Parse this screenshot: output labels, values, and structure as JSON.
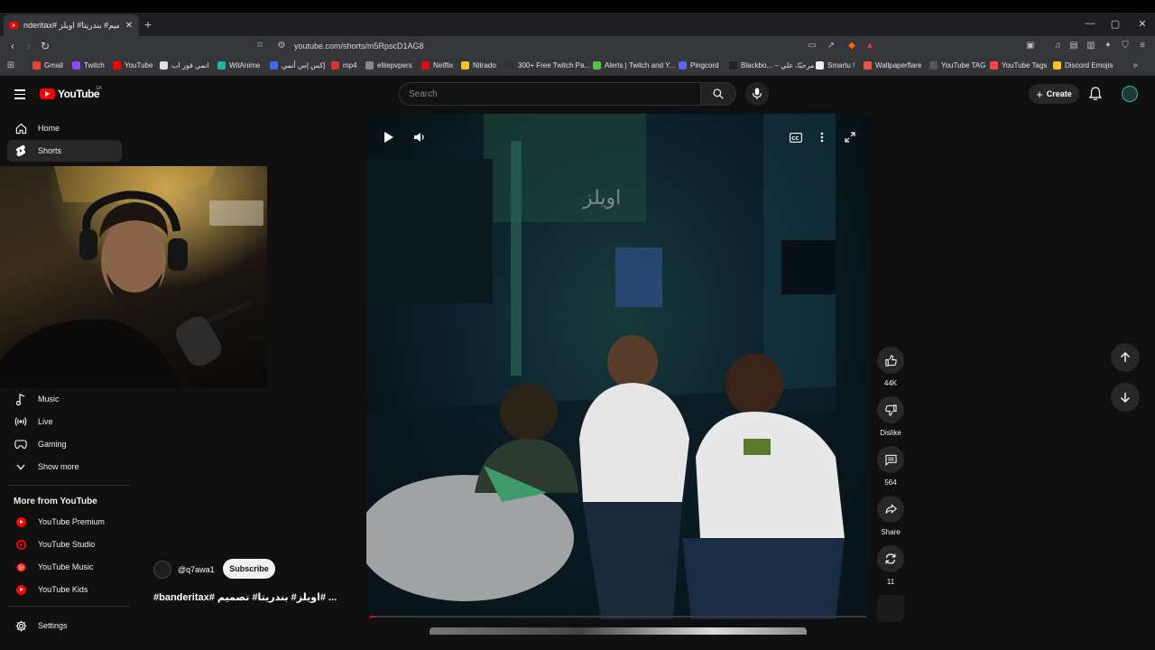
{
  "browser": {
    "tab_title": "nderitax# تصميم# بندريتا# اويلز#",
    "url": "youtube.com/shorts/m5RpscD1AG8",
    "bookmarks": [
      {
        "label": "Gmail",
        "color": "#ea4335"
      },
      {
        "label": "Twitch",
        "color": "#9146ff"
      },
      {
        "label": "YouTube",
        "color": "#ff0000"
      },
      {
        "label": "انمي فور اب",
        "color": "#e0e0e0"
      },
      {
        "label": "WitAnime",
        "color": "#1fb5a5"
      },
      {
        "label": "إكس إس أنمي",
        "color": "#3a6ee8"
      },
      {
        "label": "mp4",
        "color": "#d33"
      },
      {
        "label": "elitepvpers",
        "color": "#888"
      },
      {
        "label": "Netflix",
        "color": "#e50914"
      },
      {
        "label": "Nitrado",
        "color": "#f5c518"
      },
      {
        "label": "300+ Free Twitch Pa...",
        "color": "#333"
      },
      {
        "label": "Alerts | Twitch and Y...",
        "color": "#53c24b"
      },
      {
        "label": "Pingcord",
        "color": "#5865f2"
      },
      {
        "label": "Blackbo... – مرحبًا، علي",
        "color": "#222"
      },
      {
        "label": "Smartu !",
        "color": "#eee"
      },
      {
        "label": "Wallpaperflare",
        "color": "#e54"
      },
      {
        "label": "YouTube TAG",
        "color": "#555"
      },
      {
        "label": "YouTube Tags",
        "color": "#f44"
      },
      {
        "label": "Discord Emojis",
        "color": "#f5c518"
      }
    ]
  },
  "header": {
    "logo_text": "YouTube",
    "country_code": "SA",
    "search_placeholder": "Search",
    "create_label": "Create"
  },
  "sidebar": {
    "top_items": [
      {
        "label": "Home",
        "icon": "home-icon"
      },
      {
        "label": "Shorts",
        "icon": "shorts-icon"
      }
    ],
    "explore_items": [
      {
        "label": "Music",
        "icon": "music-icon"
      },
      {
        "label": "Live",
        "icon": "live-icon"
      },
      {
        "label": "Gaming",
        "icon": "gaming-icon"
      },
      {
        "label": "Show more",
        "icon": "chevron-down-icon"
      }
    ],
    "more_heading": "More from YouTube",
    "more_items": [
      {
        "label": "YouTube Premium"
      },
      {
        "label": "YouTube Studio"
      },
      {
        "label": "YouTube Music"
      },
      {
        "label": "YouTube Kids"
      }
    ],
    "settings_label": "Settings"
  },
  "short": {
    "channel": "@q7awa1",
    "subscribe_label": "Subscribe",
    "title": "#banderitax# اويلز# بندريتا# تصميم# ...",
    "watermark": "اويلز",
    "likes": "44K",
    "dislike_label": "Dislike",
    "comments": "564",
    "share_label": "Share",
    "remixes": "11",
    "progress": 0.01
  },
  "colors": {
    "accent": "#ff0000",
    "background": "#0f0f0f",
    "button_bg": "#272727"
  }
}
